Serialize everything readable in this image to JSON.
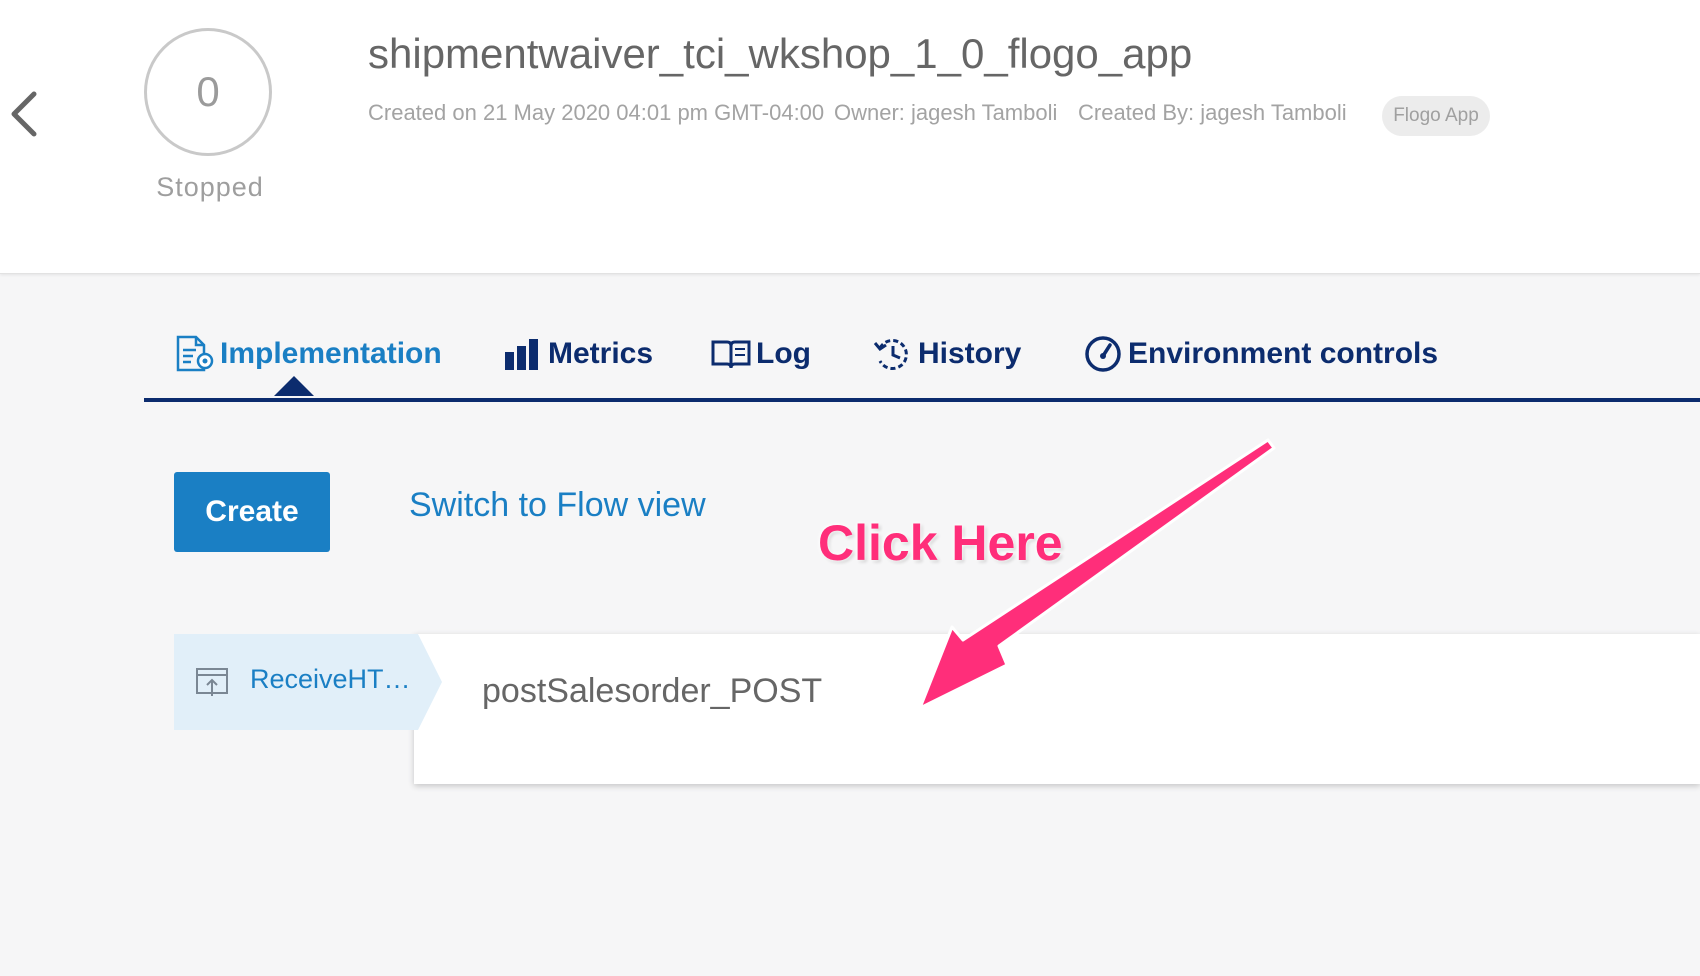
{
  "header": {
    "status_count": "0",
    "status_label": "Stopped",
    "app_title": "shipmentwaiver_tci_wkshop_1_0_flogo_app",
    "created_on": "Created on 21 May 2020 04:01 pm GMT-04:00",
    "owner": "Owner: jagesh Tamboli",
    "created_by": "Created By: jagesh Tamboli",
    "app_type": "Flogo App"
  },
  "tabs": [
    {
      "label": "Implementation",
      "icon": "implementation-icon",
      "active": true
    },
    {
      "label": "Metrics",
      "icon": "bar-chart-icon",
      "active": false
    },
    {
      "label": "Log",
      "icon": "book-icon",
      "active": false
    },
    {
      "label": "History",
      "icon": "history-icon",
      "active": false
    },
    {
      "label": "Environment controls",
      "icon": "gauge-icon",
      "active": false
    }
  ],
  "actions": {
    "create_label": "Create",
    "switch_view_label": "Switch to Flow view"
  },
  "annotation": {
    "text": "Click Here",
    "color": "#ff2e7a"
  },
  "flows": [
    {
      "trigger_label": "ReceiveHT…",
      "trigger_icon": "http-trigger-icon",
      "name": "postSalesorder_POST"
    }
  ],
  "colors": {
    "accent": "#1a7fc4",
    "navy": "#0c2c6e",
    "trigger_bg": "#e1eff9"
  }
}
